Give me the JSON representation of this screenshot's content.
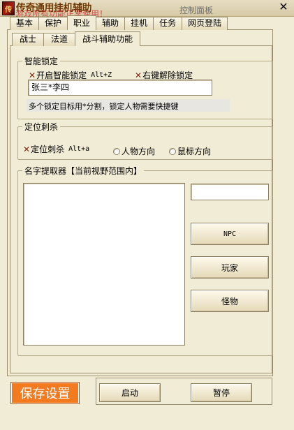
{
  "titlebar": {
    "app_title": "传奇通用挂机辅助",
    "marquee": "游戏所有功能正常使用！",
    "window_title": "控制面板",
    "close_label": "✕"
  },
  "main_tabs": [
    {
      "label": "基本"
    },
    {
      "label": "保护"
    },
    {
      "label": "职业",
      "active": true
    },
    {
      "label": "辅助"
    },
    {
      "label": "挂机"
    },
    {
      "label": "任务"
    },
    {
      "label": "网页登陆"
    }
  ],
  "sub_tabs": [
    {
      "label": "战士"
    },
    {
      "label": "法道"
    },
    {
      "label": "战斗辅助功能",
      "active": true
    }
  ],
  "smart_lock": {
    "legend": "智能锁定",
    "enable_label": "开启智能锁定",
    "enable_hotkey": "Alt+Z",
    "right_unlock_label": "右键解除锁定",
    "targets_value": "张三*李四",
    "hint": "多个锁定目标用*分割，锁定人物需要快捷键"
  },
  "position_kill": {
    "legend": "定位刺杀",
    "enable_label": "定位刺杀",
    "hotkey": "Alt+a",
    "radio_char": "人物方向",
    "radio_mouse": "鼠标方向"
  },
  "name_extractor": {
    "legend": "名字提取器【当前视野范围内】",
    "filter_value": "",
    "btn_npc": "NPC",
    "btn_player": "玩家",
    "btn_monster": "怪物"
  },
  "footer": {
    "save_label": "保存设置",
    "start_label": "启动",
    "pause_label": "暂停"
  },
  "icons": {
    "checkbox_checked": "✕",
    "app_icon": "传"
  },
  "colors": {
    "window_bg": "#f1ecd5",
    "save_button": "#f47a1f",
    "check_mark": "#7a2a10"
  }
}
